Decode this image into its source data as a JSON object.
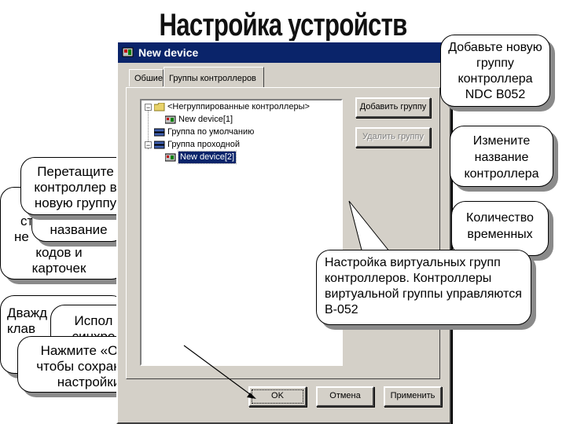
{
  "slide": {
    "title": "Настройка устройств"
  },
  "dialog": {
    "title": "New device",
    "tabs": [
      {
        "label": "Обшие"
      },
      {
        "label": "Группы контроллеров"
      }
    ],
    "tree": {
      "items": [
        {
          "label": "<Негруппированные контроллеры>",
          "expander": "−"
        },
        {
          "label": "New device[1]"
        },
        {
          "label": "Группа по умолчанию"
        },
        {
          "label": "Группа проходной",
          "expander": "−"
        },
        {
          "label": "New device[2]",
          "selected": true
        }
      ]
    },
    "buttons": {
      "add_group": "Добавить группу",
      "delete_group": "Удалить группу",
      "ok": "OK",
      "cancel": "Отмена",
      "apply": "Применить"
    }
  },
  "callouts": {
    "add_group": "Добавьте новую группу контроллера NDC B052",
    "rename": "Измените название контроллера",
    "count": "Количество временных",
    "virtual": "Настройка виртуальных групп контроллеров. Контроллеры виртуальной группы управляются B-052",
    "drag_line1": "Перетащите",
    "drag_line2": "контроллер в",
    "drag_line3": "новую группу",
    "left_partial_1": "ст",
    "left_partial_2": "название",
    "left_partial_3": "не",
    "codes_line1": "кодов и",
    "codes_line2": "карточек",
    "dblclick_partial": "Дважд",
    "dblclick_partial2": "клав",
    "use_partial": "Испол",
    "use_partial2": "синхро",
    "ok_hint": "Нажмите «ОК», чтобы сохранить настройки"
  },
  "colors": {
    "titlebar": "#0a246a",
    "dialog_face": "#d4d0c8",
    "callout_shadow": "#8a8a8a"
  }
}
